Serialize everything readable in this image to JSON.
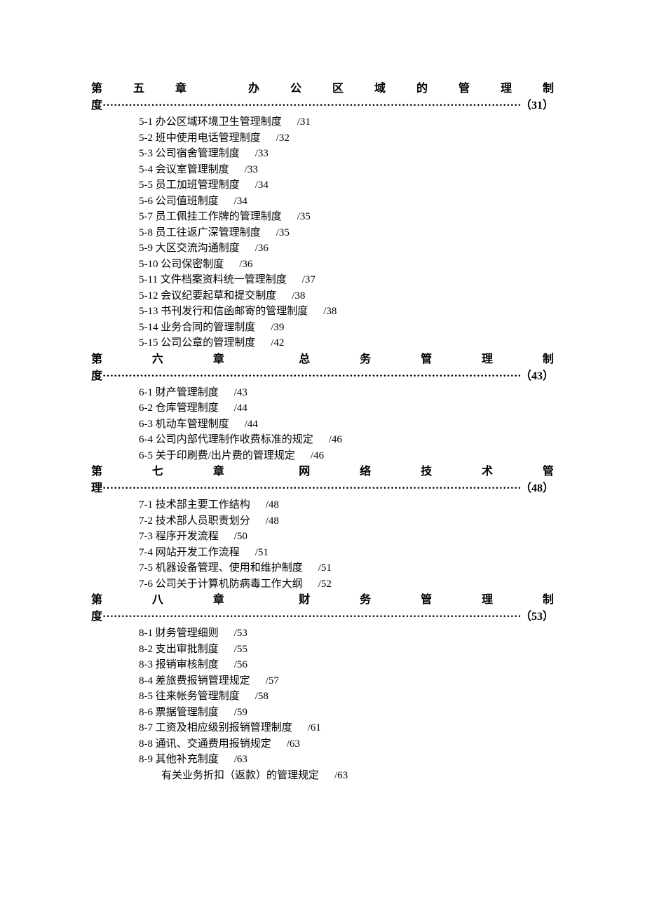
{
  "dots": "··············································································································································································",
  "chapters": [
    {
      "head_chars": [
        "第",
        "五",
        "章",
        "",
        "办",
        "公",
        "区",
        "域",
        "的",
        "管",
        "理",
        "制"
      ],
      "tail_char": "度",
      "page": "（31）",
      "items": [
        {
          "idx": "5-1",
          "title": "办公区域环境卫生管理制度",
          "page": "/31"
        },
        {
          "idx": "5-2",
          "title": "班中使用电话管理制度",
          "page": "/32"
        },
        {
          "idx": "5-3",
          "title": "公司宿舍管理制度",
          "page": "/33"
        },
        {
          "idx": "5-4",
          "title": "会议室管理制度",
          "page": "/33"
        },
        {
          "idx": "5-5",
          "title": "员工加班管理制度",
          "page": "/34"
        },
        {
          "idx": "5-6",
          "title": "公司值班制度",
          "page": "/34"
        },
        {
          "idx": "5-7",
          "title": "员工佩挂工作牌的管理制度",
          "page": "/35"
        },
        {
          "idx": "5-8",
          "title": "员工往返广深管理制度",
          "page": "/35"
        },
        {
          "idx": "5-9",
          "title": "大区交流沟通制度",
          "page": "/36"
        },
        {
          "idx": "5-10",
          "title": "公司保密制度",
          "page": "/36"
        },
        {
          "idx": "5-11",
          "title": "文件档案资料统一管理制度",
          "page": "/37"
        },
        {
          "idx": "5-12",
          "title": "会议纪要起草和提交制度",
          "page": "/38"
        },
        {
          "idx": "5-13",
          "title": "书刊发行和信函邮寄的管理制度",
          "page": "/38"
        },
        {
          "idx": "5-14",
          "title": "业务合同的管理制度",
          "page": "/39"
        },
        {
          "idx": "5-15",
          "title": "公司公章的管理制度",
          "page": "/42"
        }
      ]
    },
    {
      "head_chars": [
        "第",
        "",
        "六",
        "",
        "章",
        "",
        "",
        "总",
        "",
        "务",
        "",
        "管",
        "",
        "理",
        "",
        "制"
      ],
      "tail_char": "度",
      "page": "（43）",
      "items": [
        {
          "idx": "6-1",
          "title": "财产管理制度",
          "page": "/43"
        },
        {
          "idx": "6-2",
          "title": "仓库管理制度",
          "page": "/44"
        },
        {
          "idx": "6-3",
          "title": "机动车管理制度",
          "page": "/44"
        },
        {
          "idx": "6-4",
          "title": "公司内部代理制作收费标准的规定",
          "page": "/46"
        },
        {
          "idx": "6-5",
          "title": "关于印刷费/出片费的管理规定",
          "page": "/46"
        }
      ]
    },
    {
      "head_chars": [
        "第",
        "",
        "七",
        "",
        "章",
        "",
        "",
        "网",
        "",
        "络",
        "",
        "技",
        "",
        "术",
        "",
        "管"
      ],
      "tail_char": "理",
      "page": "（48）",
      "items": [
        {
          "idx": "7-1",
          "title": "技术部主要工作结构",
          "page": "/48"
        },
        {
          "idx": "7-2",
          "title": "技术部人员职责划分",
          "page": "/48"
        },
        {
          "idx": "7-3",
          "title": "程序开发流程",
          "page": "/50"
        },
        {
          "idx": "7-4",
          "title": "网站开发工作流程",
          "page": "/51"
        },
        {
          "idx": "7-5",
          "title": "机器设备管理、使用和维护制度",
          "page": "/51"
        },
        {
          "idx": "7-6",
          "title": "公司关于计算机防病毒工作大纲",
          "page": "/52"
        }
      ]
    },
    {
      "head_chars": [
        "第",
        "",
        "八",
        "",
        "章",
        "",
        "",
        "财",
        "",
        "务",
        "",
        "管",
        "",
        "理",
        "",
        "制"
      ],
      "tail_char": "度",
      "page": "（53）",
      "items": [
        {
          "idx": "8-1",
          "title": "财务管理细则",
          "page": "/53"
        },
        {
          "idx": "8-2",
          "title": "支出审批制度",
          "page": "/55"
        },
        {
          "idx": "8-3",
          "title": "报销审核制度",
          "page": "/56"
        },
        {
          "idx": "8-4",
          "title": "差旅费报销管理规定",
          "page": "/57"
        },
        {
          "idx": "8-5",
          "title": "往来帐务管理制度",
          "page": "/58"
        },
        {
          "idx": "8-6",
          "title": "票据管理制度",
          "page": "/59"
        },
        {
          "idx": "8-7",
          "title": "工资及相应级别报销管理制度",
          "page": "/61"
        },
        {
          "idx": "8-8",
          "title": "通讯、交通费用报销规定",
          "page": "/63"
        },
        {
          "idx": "8-9",
          "title": "其他补充制度",
          "page": "/63"
        },
        {
          "idx": "",
          "title": "有关业务折扣（返款）的管理规定",
          "page": "/63",
          "noidx": true
        }
      ]
    }
  ]
}
